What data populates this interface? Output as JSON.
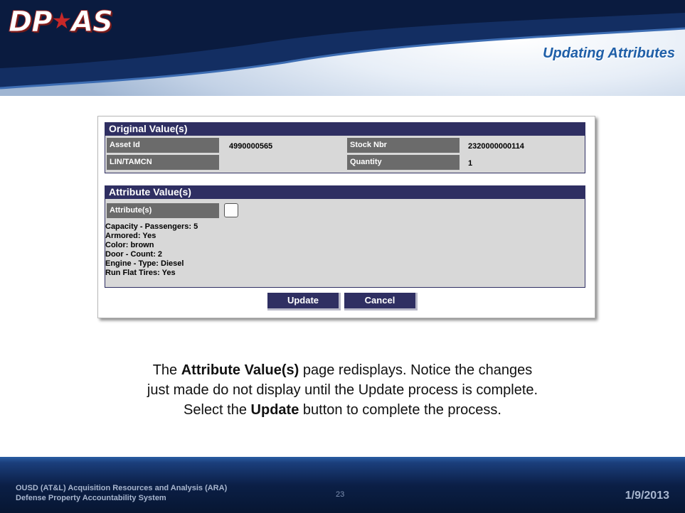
{
  "brand": {
    "logo_text_pre": "DP",
    "logo_star": "★",
    "logo_text_post": "AS"
  },
  "slide_title": "Updating Attributes",
  "original_values": {
    "section_title": "Original Value(s)",
    "asset_id_label": "Asset Id",
    "asset_id_value": "4990000565",
    "stock_nbr_label": "Stock Nbr",
    "stock_nbr_value": "2320000000114",
    "lin_tamcn_label": "LIN/TAMCN",
    "lin_tamcn_value": "",
    "quantity_label": "Quantity",
    "quantity_value": "1"
  },
  "attribute_values": {
    "section_title": "Attribute Value(s)",
    "attributes_label": "Attribute(s)",
    "list": [
      "Capacity - Passengers: 5",
      "Armored: Yes",
      "Color: brown",
      "Door - Count: 2",
      "Engine - Type: Diesel",
      "Run Flat Tires: Yes"
    ]
  },
  "buttons": {
    "update": "Update",
    "cancel": "Cancel"
  },
  "caption": {
    "line1_pre": "The ",
    "line1_bold": "Attribute Value(s)",
    "line1_post": " page redisplays. Notice the changes",
    "line2": "just made do not display until the Update process is complete.",
    "line3_pre": "Select the ",
    "line3_bold": "Update",
    "line3_post": " button to complete the process."
  },
  "footer": {
    "org_line1": "OUSD (AT&L) Acquisition Resources and Analysis (ARA)",
    "org_line2": "Defense Property Accountability System",
    "page_number": "23",
    "date": "1/9/2013"
  },
  "colors": {
    "section_bar": "#2f2f62",
    "label_cell": "#6b6b6b",
    "title_blue": "#1f5fa8",
    "footer_navy": "#0b1f46"
  }
}
